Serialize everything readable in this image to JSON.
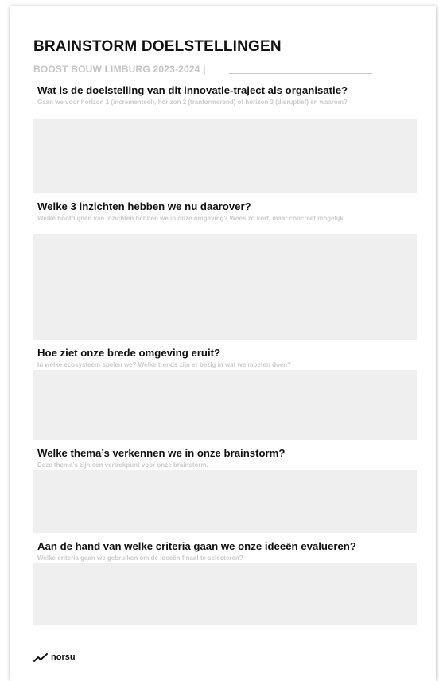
{
  "header": {
    "title": "BRAINSTORM DOELSTELLINGEN",
    "subtitle": "BOOST BOUW LIMBURG 2023-2024 |"
  },
  "sections": [
    {
      "question": "Wat is de doelstelling van dit innovatie-traject als organisatie?",
      "hint": "Gaan we voor horizon 1 (incrementeel), horizon 2 (tranformerend) of horizon 3 (disruptief) en waarom?"
    },
    {
      "question": "Welke 3 inzichten hebben we nu daarover?",
      "hint": "Welke hoofdlijnen van inzichten hebben we in onze omgeving? Wees zo kort, maar concreet mogelijk."
    },
    {
      "question": "Hoe ziet onze brede omgeving eruit?",
      "hint": "In welke ecosysteem spelen we? Welke trends zijn er bezig in wat we moeten doen?"
    },
    {
      "question": "Welke thema’s verkennen we in onze brainstorm?",
      "hint": "Deze thema’s zijn een vertrekpunt voor onze brainstorm."
    },
    {
      "question": "Aan de hand van welke criteria gaan we onze ideeën evalueren?",
      "hint": "Welke criteria gaan we gebruiken om de ideeën finaal te selecteren?"
    }
  ],
  "footer": {
    "logo_text": "norsu",
    "logo_icon": "trend-line-icon"
  }
}
